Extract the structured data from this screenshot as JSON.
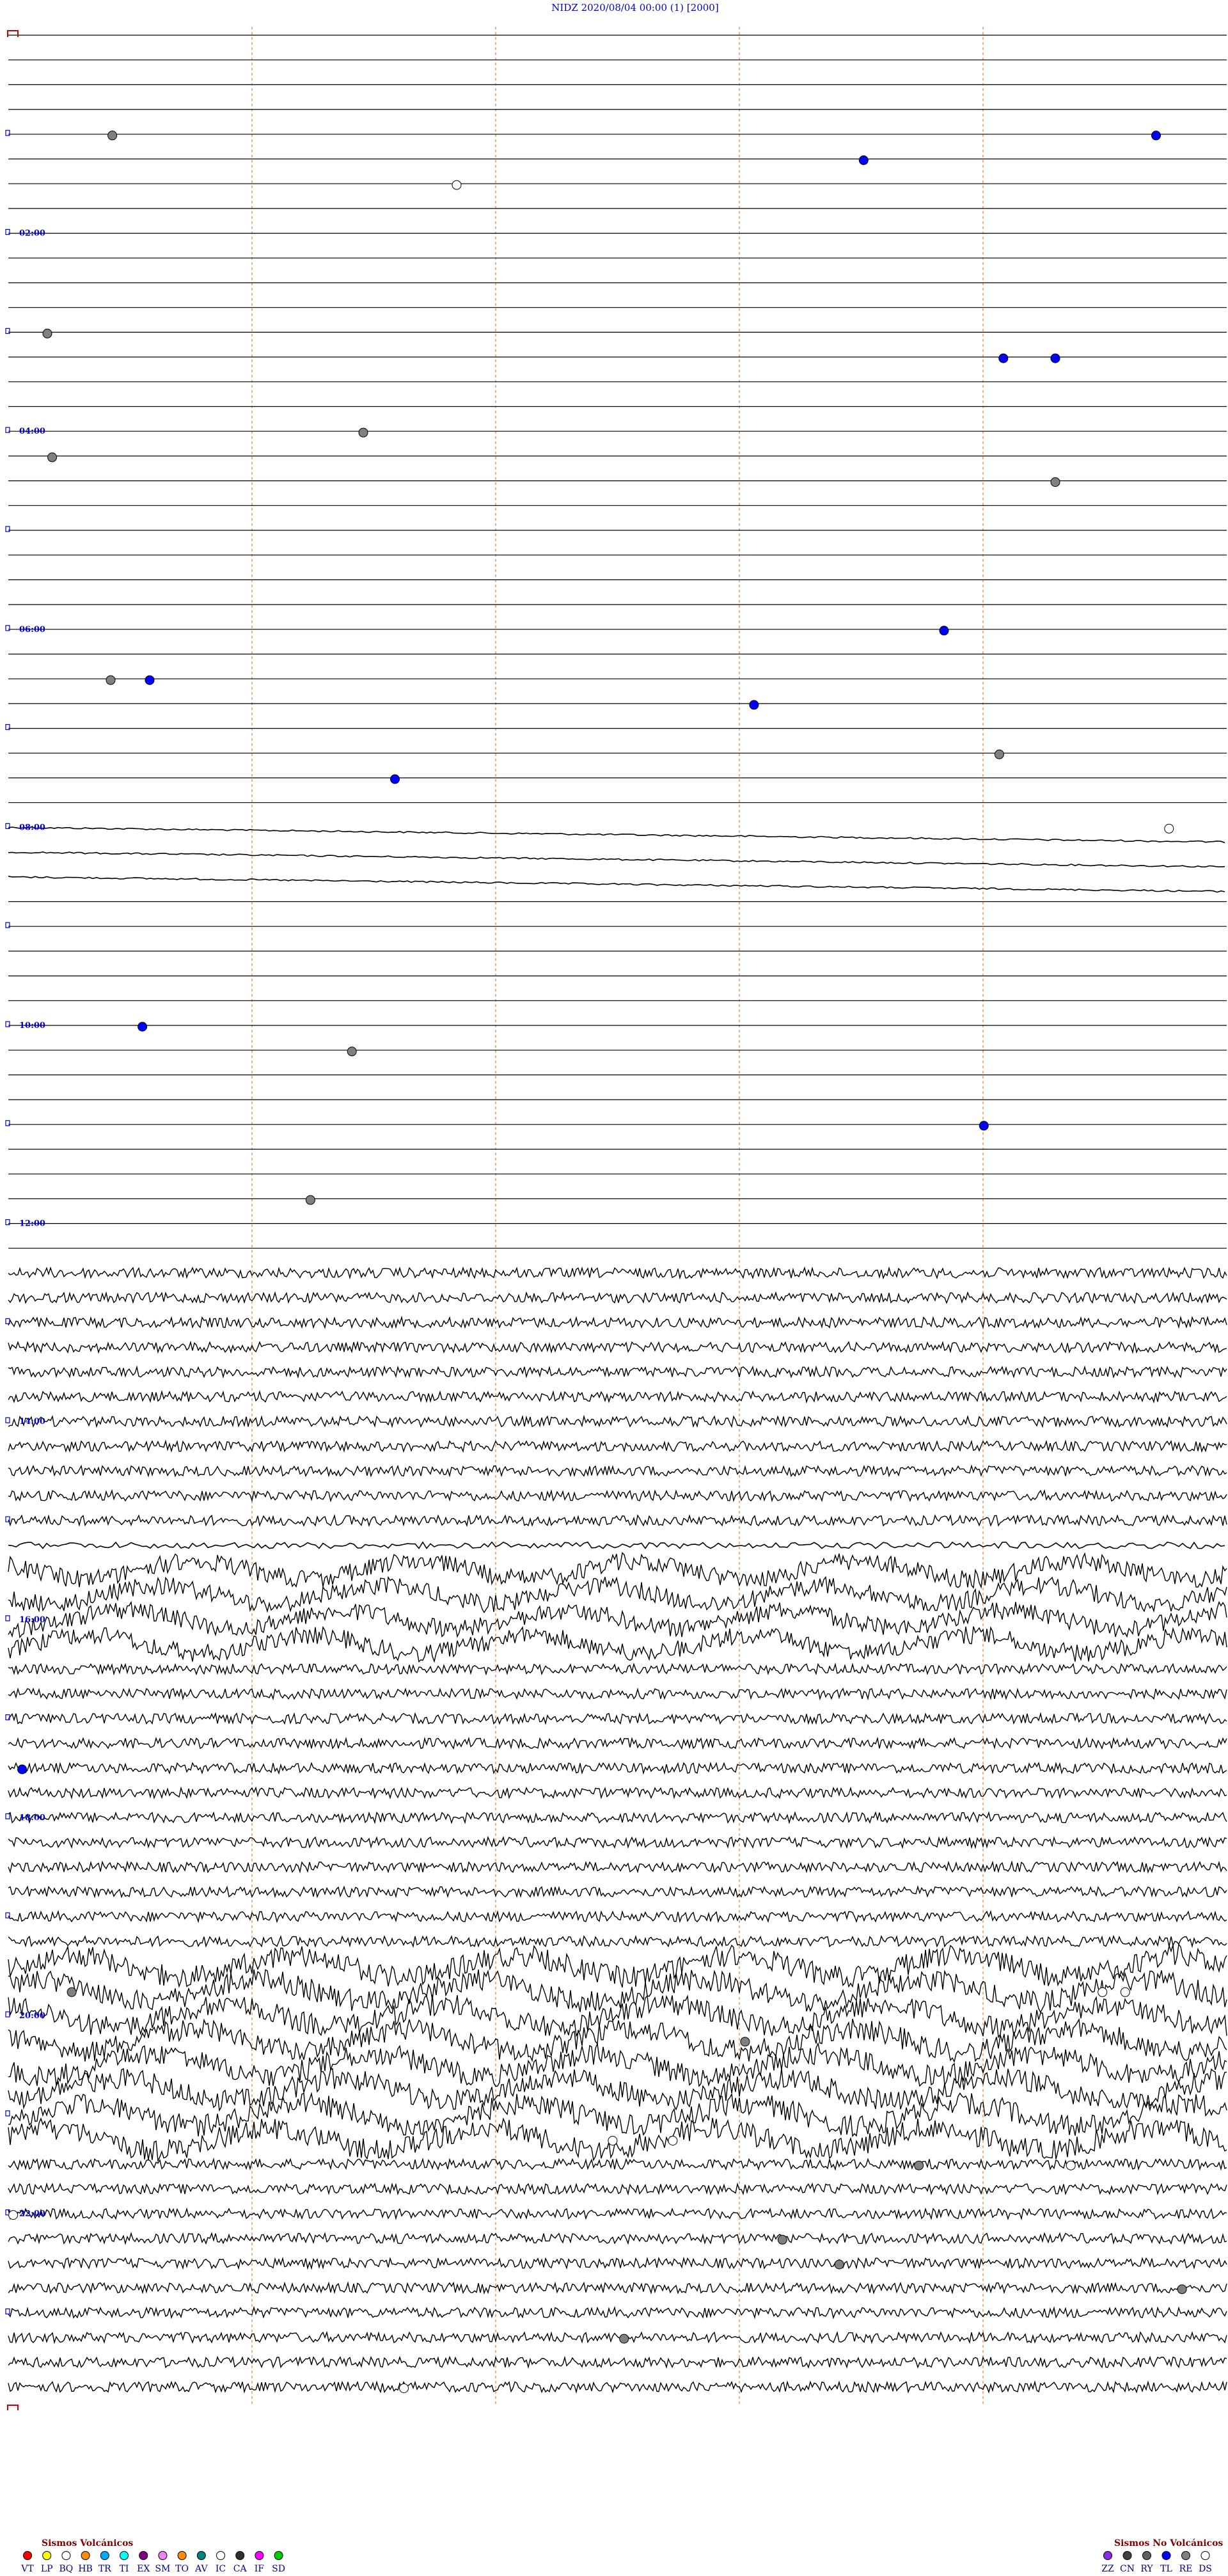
{
  "header": {
    "station": "NIDZ",
    "datetime": "2020/08/04 00:00",
    "channel": "(1)",
    "scale": "[2000]"
  },
  "chart_data": {
    "type": "scatter",
    "description_axes": "helicorder: one trace per 15 minutes, 24 hours",
    "x_range_minutes": [
      0,
      15
    ],
    "rows_per_hour": 4,
    "total_rows": 96,
    "hour_labels": [
      "02:00",
      "04:00",
      "06:00",
      "08:00",
      "10:00",
      "12:00",
      "14:00",
      "16:00",
      "18:00",
      "20:00",
      "22:00"
    ],
    "legend_volcanic_title": "Sismos Volcánicos",
    "legend_volcanic": [
      {
        "code": "VT",
        "color": "#ff0000"
      },
      {
        "code": "LP",
        "color": "#ffff00"
      },
      {
        "code": "BQ",
        "color": "#ffffff"
      },
      {
        "code": "HB",
        "color": "#ff8c00"
      },
      {
        "code": "TR",
        "color": "#00aaff"
      },
      {
        "code": "TI",
        "color": "#00ffff"
      },
      {
        "code": "EX",
        "color": "#800080"
      },
      {
        "code": "SM",
        "color": "#ee82ee"
      },
      {
        "code": "TO",
        "color": "#ff8c00"
      },
      {
        "code": "AV",
        "color": "#008080"
      },
      {
        "code": "IC",
        "color": "#ffffff"
      },
      {
        "code": "CA",
        "color": "#303030"
      },
      {
        "code": "IF",
        "color": "#ff00ff"
      },
      {
        "code": "SD",
        "color": "#00cc00"
      }
    ],
    "legend_nonvolcanic_title": "Sismos No Volcánicos",
    "legend_nonvolcanic": [
      {
        "code": "ZZ",
        "color": "#8a2be2"
      },
      {
        "code": "CN",
        "color": "#404040"
      },
      {
        "code": "RY",
        "color": "#606060"
      },
      {
        "code": "TL",
        "color": "#0000ff"
      },
      {
        "code": "RE",
        "color": "#808080"
      },
      {
        "code": "DS",
        "color": "#ffffff"
      }
    ],
    "events": [
      {
        "row": 4,
        "minute": 1.28,
        "type": "RE"
      },
      {
        "row": 4,
        "minute": 14.13,
        "type": "TL"
      },
      {
        "row": 5,
        "minute": 10.53,
        "type": "TL"
      },
      {
        "row": 6,
        "minute": 5.52,
        "type": "DS"
      },
      {
        "row": 12,
        "minute": 0.48,
        "type": "RE"
      },
      {
        "row": 13,
        "minute": 12.25,
        "type": "TL"
      },
      {
        "row": 13,
        "minute": 12.89,
        "type": "TL"
      },
      {
        "row": 16,
        "minute": 4.37,
        "type": "RE"
      },
      {
        "row": 17,
        "minute": 0.54,
        "type": "RE"
      },
      {
        "row": 18,
        "minute": 12.89,
        "type": "RE"
      },
      {
        "row": 24,
        "minute": 11.52,
        "type": "TL"
      },
      {
        "row": 26,
        "minute": 1.26,
        "type": "RE"
      },
      {
        "row": 26,
        "minute": 1.74,
        "type": "TL"
      },
      {
        "row": 27,
        "minute": 9.18,
        "type": "TL"
      },
      {
        "row": 29,
        "minute": 12.2,
        "type": "RE"
      },
      {
        "row": 30,
        "minute": 4.76,
        "type": "TL"
      },
      {
        "row": 32,
        "minute": 14.29,
        "type": "DS"
      },
      {
        "row": 40,
        "minute": 1.65,
        "type": "TL"
      },
      {
        "row": 41,
        "minute": 4.23,
        "type": "RE"
      },
      {
        "row": 44,
        "minute": 12.01,
        "type": "TL"
      },
      {
        "row": 47,
        "minute": 3.72,
        "type": "RE"
      },
      {
        "row": 70,
        "minute": 0.17,
        "type": "TL"
      },
      {
        "row": 79,
        "minute": 0.78,
        "type": "RE"
      },
      {
        "row": 79,
        "minute": 13.47,
        "type": "DS"
      },
      {
        "row": 79,
        "minute": 13.75,
        "type": "DS"
      },
      {
        "row": 81,
        "minute": 9.07,
        "type": "RE"
      },
      {
        "row": 85,
        "minute": 7.44,
        "type": "DS"
      },
      {
        "row": 85,
        "minute": 8.18,
        "type": "DS"
      },
      {
        "row": 86,
        "minute": 11.21,
        "type": "RE"
      },
      {
        "row": 86,
        "minute": 13.08,
        "type": "DS"
      },
      {
        "row": 88,
        "minute": 0.06,
        "type": "DS"
      },
      {
        "row": 89,
        "minute": 9.53,
        "type": "RE"
      },
      {
        "row": 90,
        "minute": 10.23,
        "type": "RE"
      },
      {
        "row": 91,
        "minute": 14.45,
        "type": "RE"
      },
      {
        "row": 93,
        "minute": 7.58,
        "type": "RE"
      },
      {
        "row": 95,
        "minute": 4.87,
        "type": "DS"
      }
    ],
    "noise_level_by_row": [
      0,
      0,
      0,
      0,
      0,
      0,
      0,
      0,
      0,
      0,
      0,
      0,
      0,
      0,
      0,
      0,
      0,
      0,
      0,
      0,
      0,
      0,
      0,
      0,
      0,
      0,
      0,
      0,
      0,
      0,
      0,
      0,
      1,
      1,
      1,
      0,
      0,
      0,
      0,
      0,
      0,
      0,
      0,
      0,
      0,
      0,
      0,
      0,
      0,
      0,
      3,
      3,
      3,
      3,
      3,
      3,
      3,
      3,
      3,
      3,
      3,
      2,
      4,
      4,
      4,
      4,
      3,
      3,
      3,
      3,
      3,
      3,
      3,
      3,
      3,
      3,
      3,
      3,
      5,
      5,
      5,
      5,
      5,
      5,
      5,
      5,
      3,
      3,
      3,
      3,
      3,
      3,
      3,
      3,
      3,
      3,
      0,
      0,
      0,
      0,
      0,
      0,
      0,
      0,
      0,
      0,
      0,
      0,
      0,
      0,
      0,
      0,
      0,
      0,
      0,
      0,
      0,
      0,
      0,
      0,
      0,
      0
    ]
  }
}
